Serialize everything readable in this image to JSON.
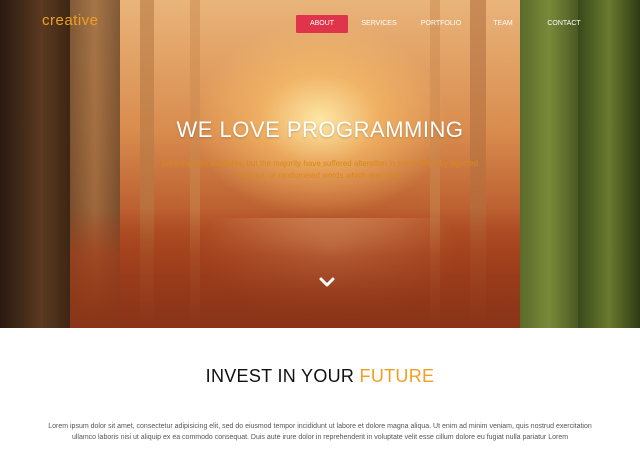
{
  "brand": {
    "logo_text": "creative",
    "accent_color": "#f0a020",
    "nav_active_color": "#e0344a"
  },
  "nav": {
    "items": [
      {
        "label": "ABOUT",
        "active": true
      },
      {
        "label": "SERVICES"
      },
      {
        "label": "PORTFOLIO"
      },
      {
        "label": "TEAM"
      },
      {
        "label": "CONTACT"
      }
    ]
  },
  "hero": {
    "title": "WE LOVE PROGRAMMING",
    "subtitle": "Lorem ipsum available, but the majority have suffered alteration in some form, by injected humour, or randomised words which don't look",
    "scroll_icon": "chevron-down-icon"
  },
  "section": {
    "heading_part1": "INVEST IN YOUR",
    "heading_part2": "FUTURE",
    "paragraph": "Lorem ipsum dolor sit amet, consectetur adipisicing elit, sed do eiusmod tempor incididunt ut labore et dolore magna aliqua. Ut enim ad minim veniam, quis nostrud exercitation ullamco laboris nisi ut aliquip ex ea commodo consequat. Duis aute irure dolor in reprehenderit in voluptate velit esse cillum dolore eu fugiat nulla pariatur Lorem"
  }
}
